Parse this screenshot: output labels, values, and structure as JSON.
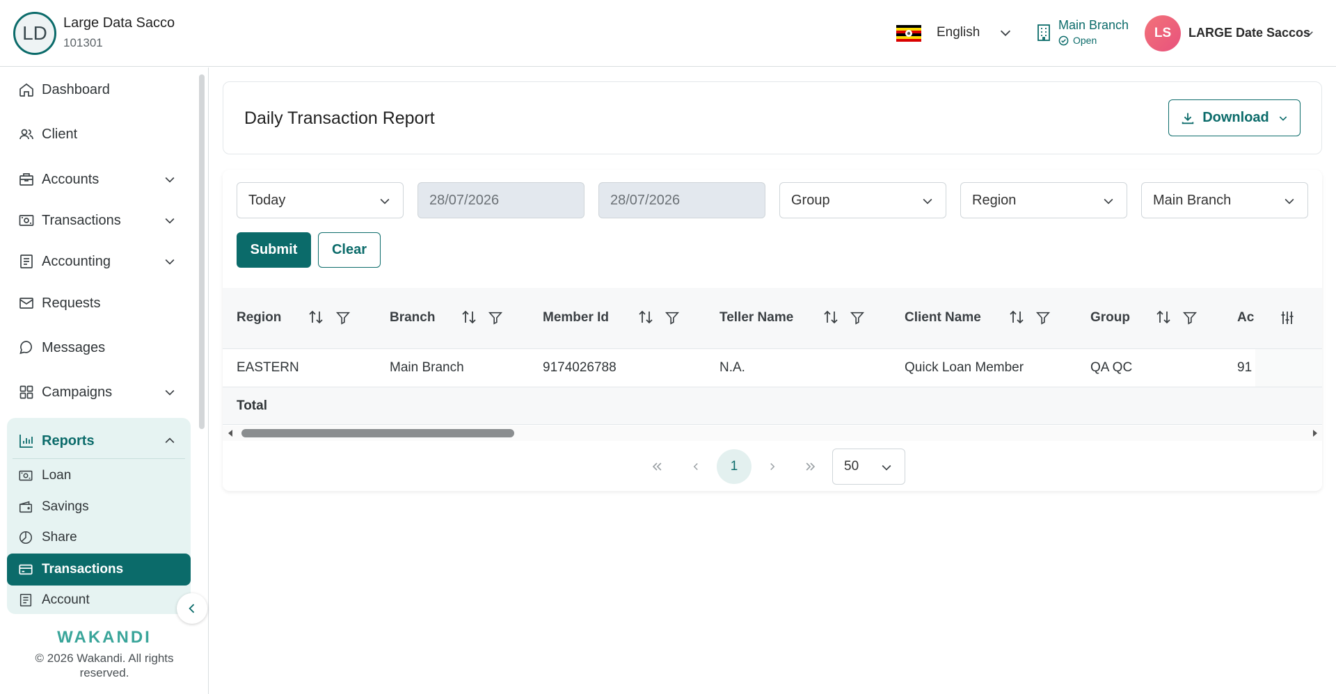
{
  "header": {
    "org_initials": "LD",
    "org_name": "Large Data Sacco",
    "org_code": "101301",
    "language": "English",
    "branch": "Main Branch",
    "branch_status": "Open",
    "user_initials": "LS",
    "user_name": "LARGE Date Saccos"
  },
  "sidebar": {
    "items": [
      {
        "label": "Dashboard",
        "icon": "home-icon"
      },
      {
        "label": "Client",
        "icon": "users-icon"
      },
      {
        "label": "Accounts",
        "icon": "briefcase-icon"
      },
      {
        "label": "Transactions",
        "icon": "cash-icon"
      },
      {
        "label": "Accounting",
        "icon": "ledger-icon"
      },
      {
        "label": "Requests",
        "icon": "mail-icon"
      },
      {
        "label": "Messages",
        "icon": "chat-icon"
      },
      {
        "label": "Campaigns",
        "icon": "grid-icon"
      }
    ],
    "reports": {
      "label": "Reports",
      "sub_items": [
        {
          "label": "Loan",
          "icon": "cash-icon"
        },
        {
          "label": "Savings",
          "icon": "wallet-icon"
        },
        {
          "label": "Share",
          "icon": "pie-icon"
        },
        {
          "label": "Transactions",
          "icon": "card-icon",
          "active": true
        },
        {
          "label": "Account",
          "icon": "ledger-icon"
        }
      ]
    },
    "brand": "WAKANDI",
    "copyright": "© 2026 Wakandi. All rights reserved."
  },
  "page": {
    "title": "Daily Transaction Report",
    "download_label": "Download"
  },
  "filters": {
    "period": "Today",
    "start_date": "28/07/2026",
    "end_date": "28/07/2026",
    "group": "Group",
    "region": "Region",
    "branch": "Main Branch",
    "submit_label": "Submit",
    "clear_label": "Clear"
  },
  "table": {
    "columns": [
      "Region",
      "Branch",
      "Member Id",
      "Teller Name",
      "Client Name",
      "Group",
      "Ac"
    ],
    "rows": [
      [
        "EASTERN",
        "Main Branch",
        "9174026788",
        "N.A.",
        "Quick Loan Member",
        "QA QC",
        "91"
      ]
    ],
    "total_label": "Total"
  },
  "pagination": {
    "current_page": "1",
    "page_size": "50"
  },
  "colors": {
    "primary": "#0b6b6a",
    "active_bg": "#e6f3f2",
    "avatar": "#ee6478"
  }
}
